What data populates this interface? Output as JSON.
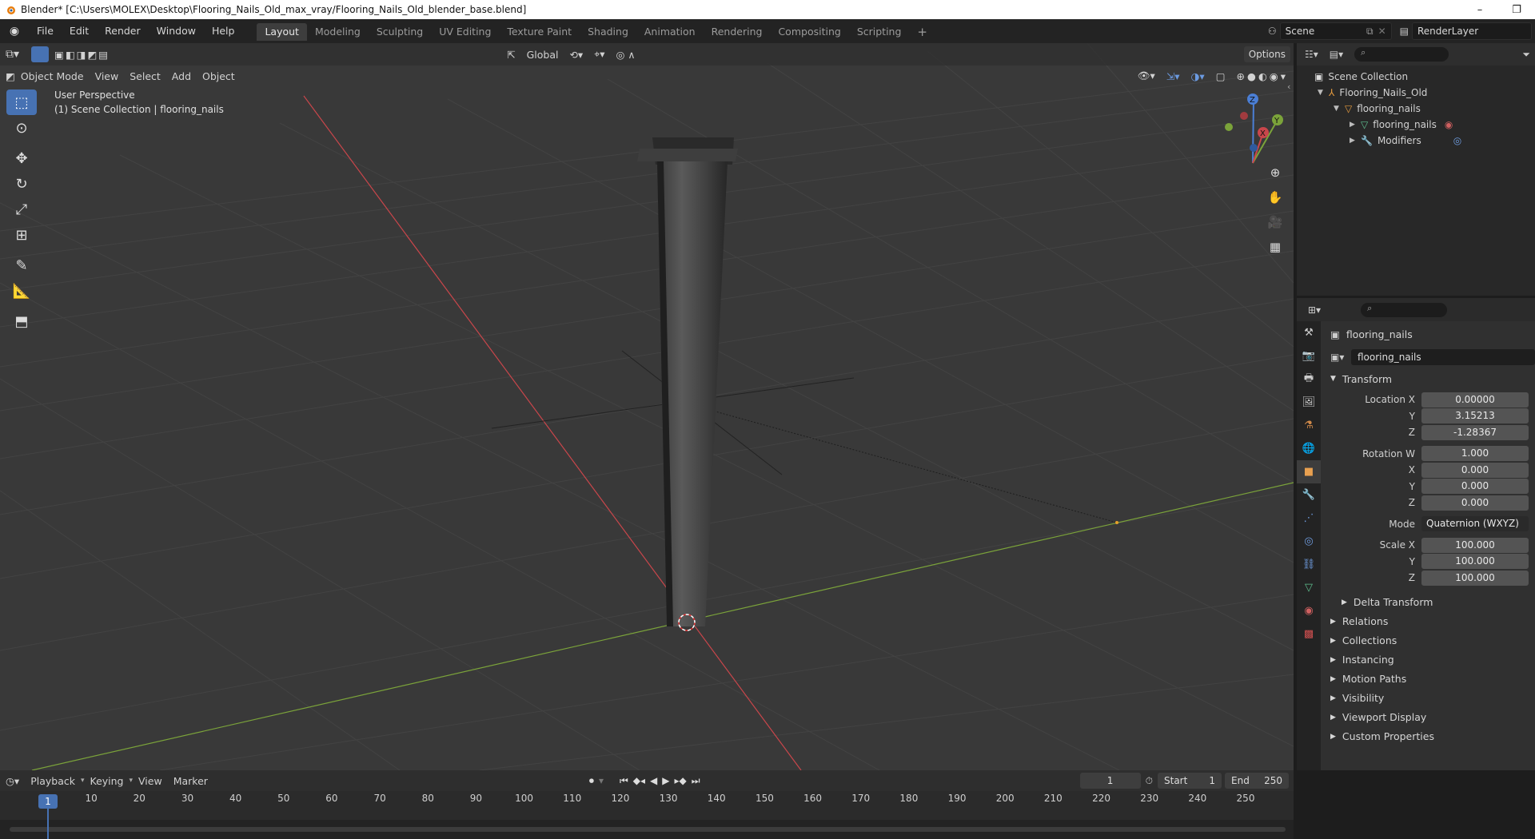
{
  "window": {
    "title": "Blender* [C:\\Users\\MOLEX\\Desktop\\Flooring_Nails_Old_max_vray/Flooring_Nails_Old_blender_base.blend]"
  },
  "menus": [
    "File",
    "Edit",
    "Render",
    "Window",
    "Help"
  ],
  "workspaces": [
    "Layout",
    "Modeling",
    "Sculpting",
    "UV Editing",
    "Texture Paint",
    "Shading",
    "Animation",
    "Rendering",
    "Compositing",
    "Scripting"
  ],
  "active_workspace": "Layout",
  "scene": {
    "name": "Scene",
    "view_layer": "RenderLayer"
  },
  "viewport": {
    "mode": "Object Mode",
    "menus": [
      "View",
      "Select",
      "Add",
      "Object"
    ],
    "orientation": "Global",
    "options_label": "Options",
    "perspective_label": "User Perspective",
    "collection_label": "(1) Scene Collection | flooring_nails"
  },
  "outliner": {
    "root": "Scene Collection",
    "collection": "Flooring_Nails_Old",
    "object": "flooring_nails",
    "mesh": "flooring_nails",
    "modifiers": "Modifiers"
  },
  "properties": {
    "object_name": "flooring_nails",
    "datablock": "flooring_nails",
    "transform_label": "Transform",
    "location": {
      "label": "Location X",
      "x": "0.00000",
      "y": "3.15213",
      "z": "-1.28367"
    },
    "rotation": {
      "label": "Rotation W",
      "w": "1.000",
      "x": "0.000",
      "y": "0.000",
      "z": "0.000"
    },
    "mode": {
      "label": "Mode",
      "value": "Quaternion (WXYZ)"
    },
    "scale": {
      "label": "Scale X",
      "x": "100.000",
      "y": "100.000",
      "z": "100.000"
    },
    "axis_labels": {
      "x": "X",
      "y": "Y",
      "z": "Z"
    },
    "delta_transform": "Delta Transform",
    "sections": [
      "Relations",
      "Collections",
      "Instancing",
      "Motion Paths",
      "Visibility",
      "Viewport Display",
      "Custom Properties"
    ]
  },
  "timeline": {
    "menus": [
      "Playback",
      "Keying",
      "View",
      "Marker"
    ],
    "current_frame": "1",
    "start_label": "Start",
    "start": "1",
    "end_label": "End",
    "end": "250",
    "ruler": [
      "1",
      "10",
      "20",
      "30",
      "40",
      "50",
      "60",
      "70",
      "80",
      "90",
      "100",
      "110",
      "120",
      "130",
      "140",
      "150",
      "160",
      "170",
      "180",
      "190",
      "200",
      "210",
      "220",
      "230",
      "240",
      "250"
    ]
  },
  "colors": {
    "accent": "#4772b3",
    "x_axis": "#c9464b",
    "y_axis": "#7ba33a",
    "origin": "#e5a02a",
    "active_tab": "#3d3d3d"
  }
}
